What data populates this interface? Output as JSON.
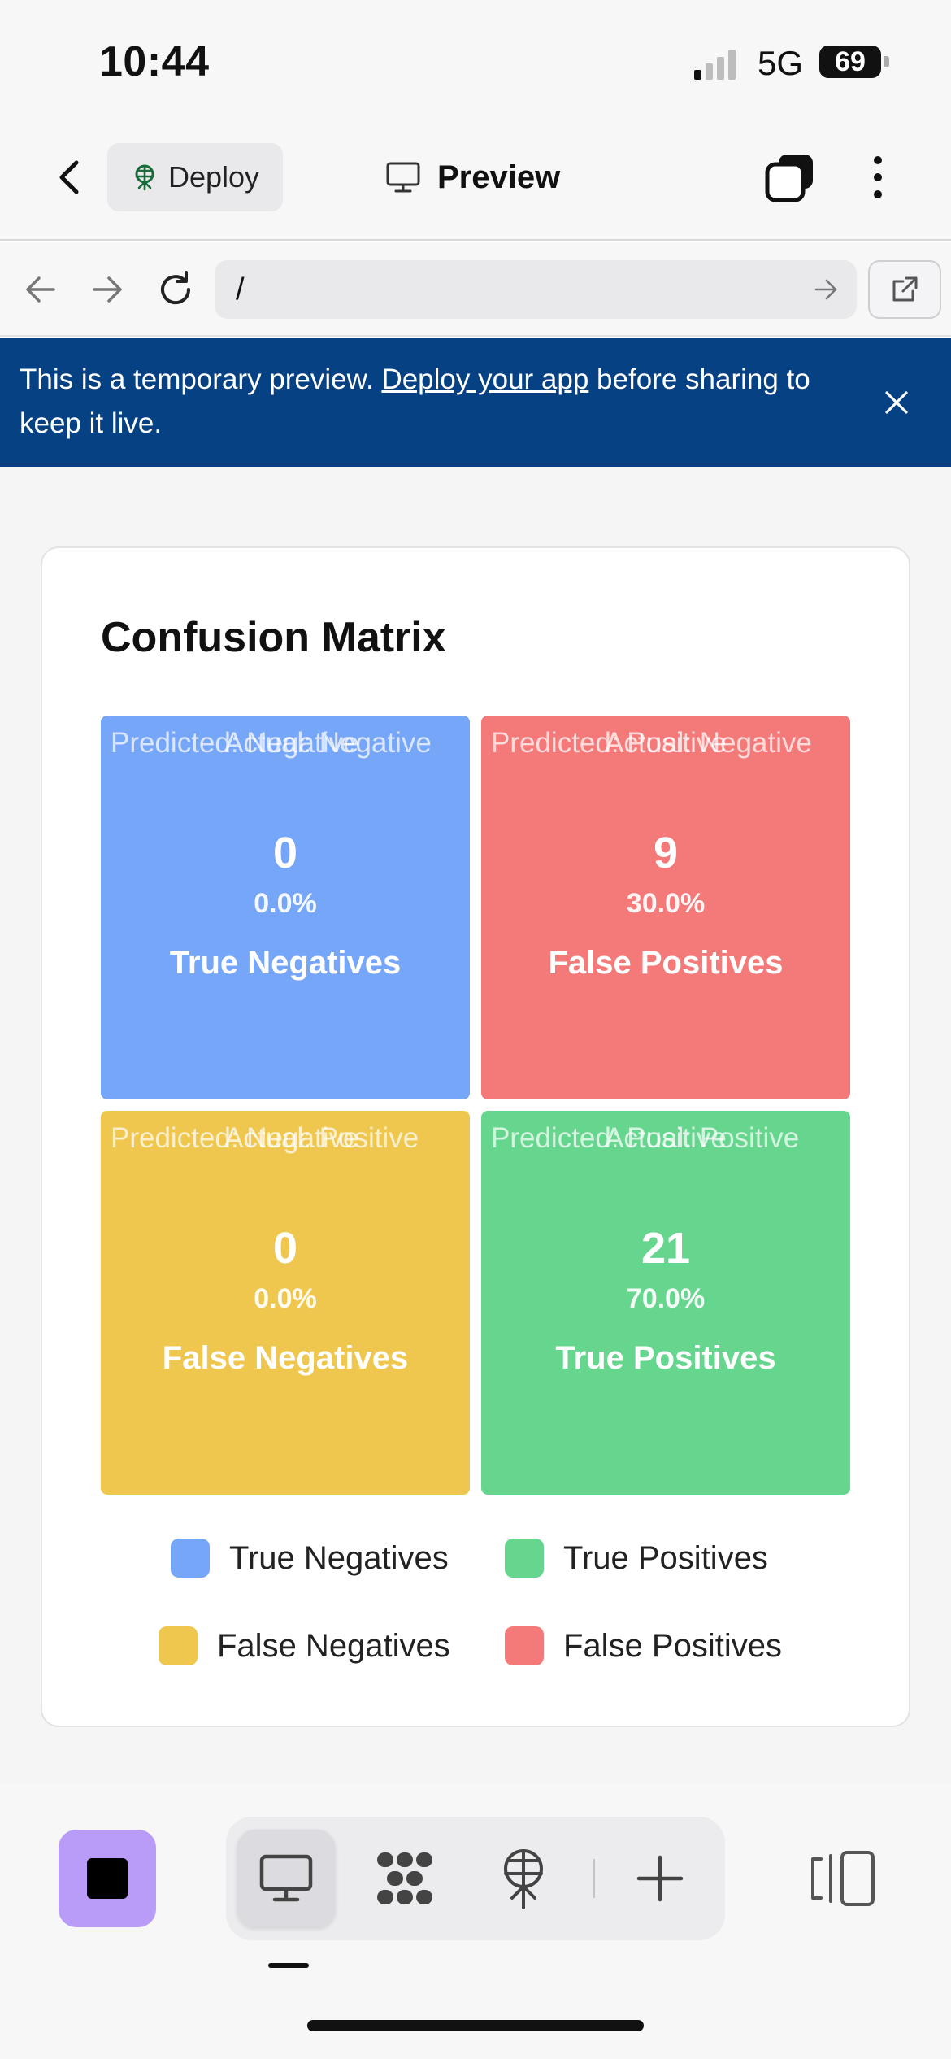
{
  "status_bar": {
    "time": "10:44",
    "network": "5G",
    "battery": "69"
  },
  "app_bar": {
    "back_icon": "chevron-left-icon",
    "deploy_label": "Deploy",
    "preview_label": "Preview",
    "tabs_icon": "tabs-icon",
    "more_icon": "more-vertical-icon"
  },
  "url_bar": {
    "url": "/"
  },
  "banner": {
    "text_before": "This is a temporary preview. ",
    "link_text": "Deploy your app",
    "text_after": " before sharing to keep it live.",
    "color": "#064183"
  },
  "card": {
    "title": "Confusion Matrix",
    "cells": [
      {
        "corner_a": "Predicted: Negative",
        "corner_b": "Actual: Negative",
        "count": "0",
        "percent": "0.0%",
        "label": "True Negatives",
        "color": "#76a6f7"
      },
      {
        "corner_a": "Predicted: Positive",
        "corner_b": "Actual: Negative",
        "count": "9",
        "percent": "30.0%",
        "label": "False Positives",
        "color": "#f47a7a"
      },
      {
        "corner_a": "Predicted: Negative",
        "corner_b": "Actual: Positive",
        "count": "0",
        "percent": "0.0%",
        "label": "False Negatives",
        "color": "#efc74f"
      },
      {
        "corner_a": "Predicted: Positive",
        "corner_b": "Actual: Positive",
        "count": "21",
        "percent": "70.0%",
        "label": "True Positives",
        "color": "#66d68e"
      }
    ],
    "legend": [
      {
        "label": "True Negatives",
        "color": "#76a6f7"
      },
      {
        "label": "True Positives",
        "color": "#66d68e"
      },
      {
        "label": "False Negatives",
        "color": "#efc74f"
      },
      {
        "label": "False Positives",
        "color": "#f47a7a"
      }
    ]
  },
  "bottom_bar": {
    "stop_color": "#b99cf7",
    "tools": [
      "monitor-icon",
      "apps-icon",
      "deploy-icon",
      "plus-icon"
    ],
    "panel_icon": "panel-toggle-icon"
  }
}
